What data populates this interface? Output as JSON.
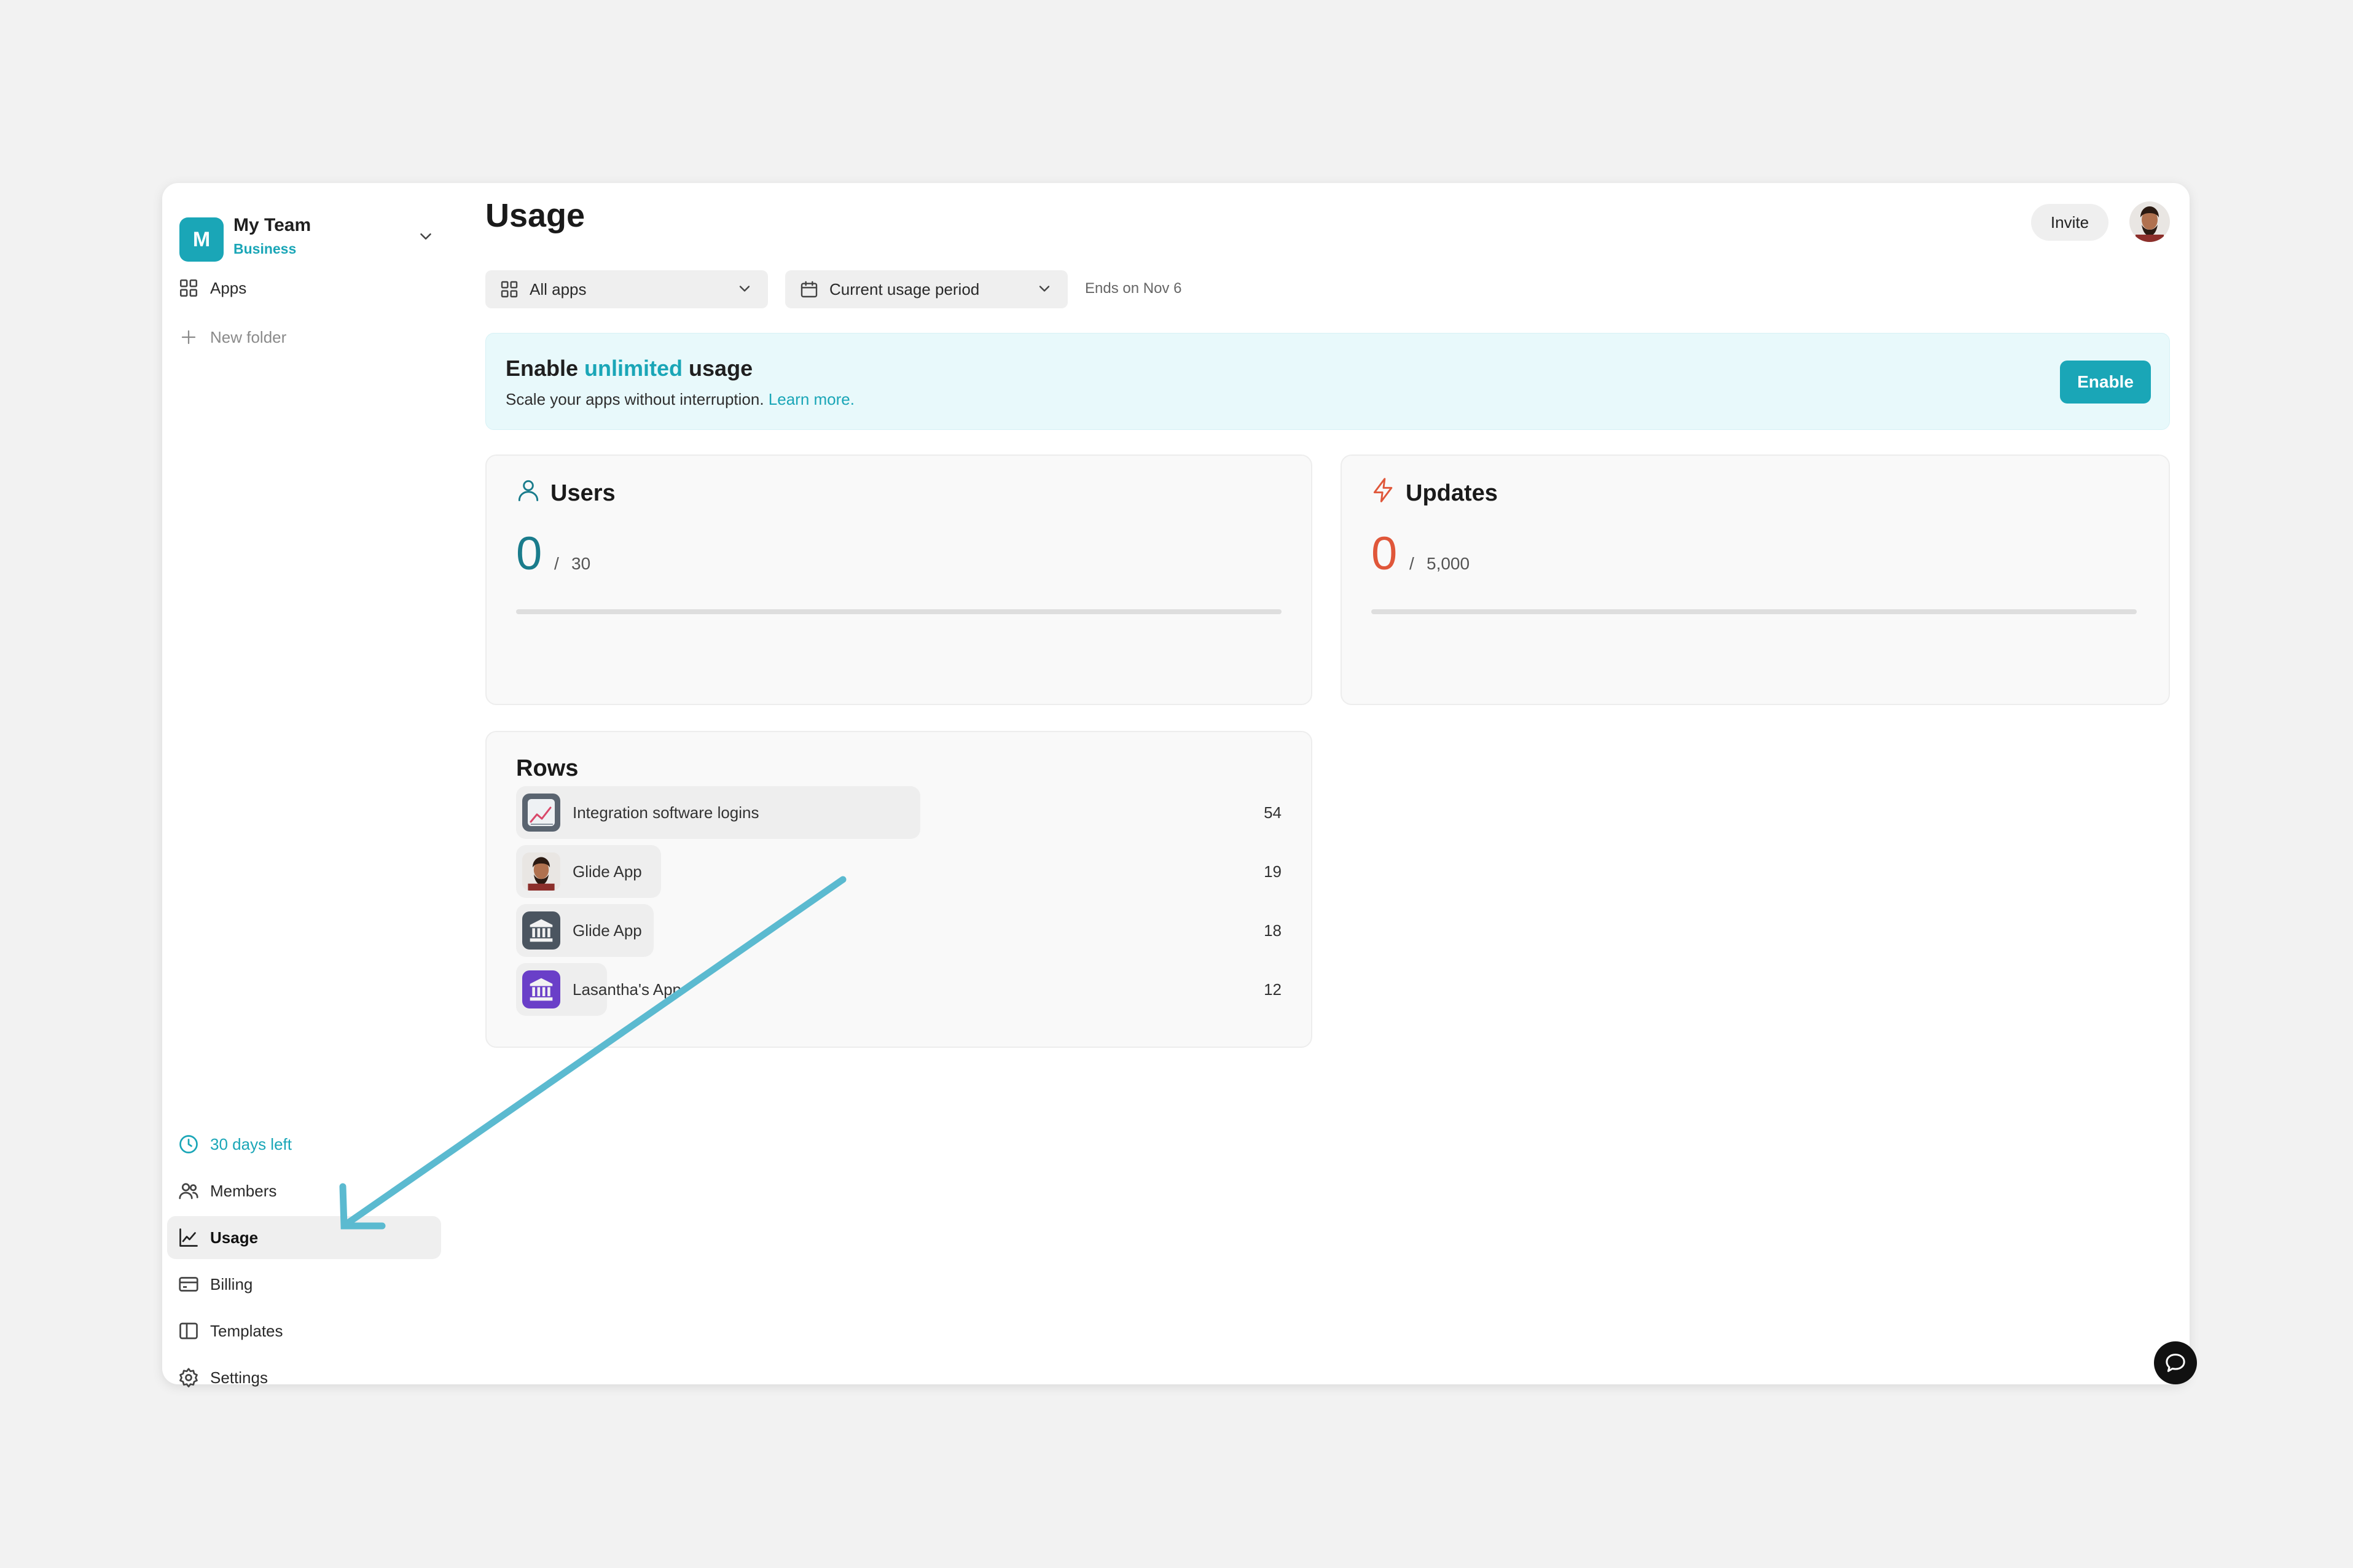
{
  "team": {
    "badge": "M",
    "name": "My Team",
    "plan": "Business"
  },
  "sidebar": {
    "top_items": [
      {
        "label": "Apps",
        "icon": "grid-icon"
      },
      {
        "label": "New folder",
        "icon": "plus-icon"
      }
    ],
    "bottom_items": [
      {
        "label": "30 days left",
        "icon": "clock-icon"
      },
      {
        "label": "Members",
        "icon": "users-icon"
      },
      {
        "label": "Usage",
        "icon": "chart-line-icon",
        "active": true
      },
      {
        "label": "Billing",
        "icon": "credit-card-icon"
      },
      {
        "label": "Templates",
        "icon": "book-icon"
      },
      {
        "label": "Settings",
        "icon": "gear-icon"
      }
    ]
  },
  "header": {
    "title": "Usage",
    "invite_label": "Invite"
  },
  "filters": {
    "apps_select": "All apps",
    "period_select": "Current usage period",
    "ends_text": "Ends on Nov 6"
  },
  "banner": {
    "title_pre": "Enable ",
    "title_highlight": "unlimited",
    "title_post": " usage",
    "subtitle": "Scale your apps without interruption. ",
    "link": "Learn more.",
    "button": "Enable"
  },
  "cards": {
    "users": {
      "title": "Users",
      "value": "0",
      "separator": "/",
      "limit": "30",
      "progress": 0,
      "color": "#1a7c8c"
    },
    "updates": {
      "title": "Updates",
      "value": "0",
      "separator": "/",
      "limit": "5,000",
      "progress": 0,
      "color": "#e0573a"
    }
  },
  "rows": {
    "title": "Rows",
    "items": [
      {
        "name": "Integration software logins",
        "count": "54",
        "icon": "chart-app-icon"
      },
      {
        "name": "Glide App",
        "count": "19",
        "icon": "avatar-app-icon"
      },
      {
        "name": "Glide App",
        "count": "18",
        "icon": "bank-app-icon"
      },
      {
        "name": "Lasantha's App",
        "count": "12",
        "icon": "bank-purple-app-icon"
      }
    ]
  },
  "colors": {
    "accent": "#1aa6b7",
    "arrow": "#5bbad0"
  }
}
